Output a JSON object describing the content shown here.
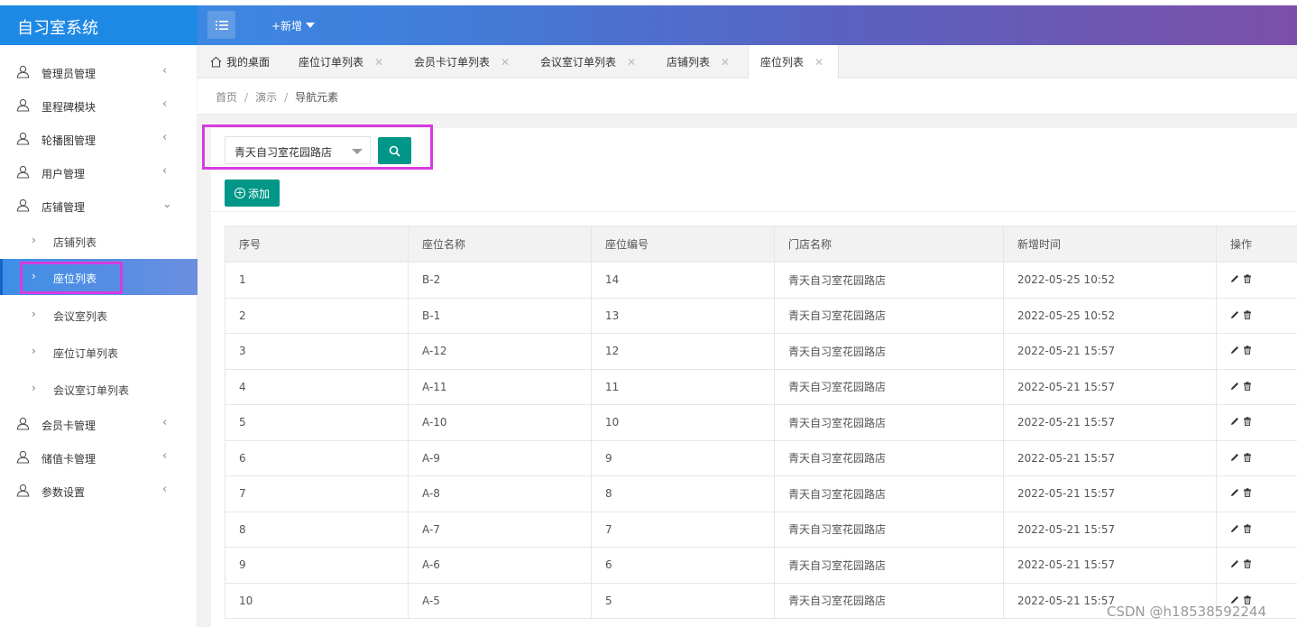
{
  "header": {
    "app_title": "自习室系统",
    "add_new_label": "+新增"
  },
  "sidebar": {
    "items": [
      {
        "label": "管理员管理"
      },
      {
        "label": "里程碑模块"
      },
      {
        "label": "轮播图管理"
      },
      {
        "label": "用户管理"
      },
      {
        "label": "店铺管理"
      }
    ],
    "sub_items": [
      {
        "label": "店铺列表"
      },
      {
        "label": "座位列表"
      },
      {
        "label": "会议室列表"
      },
      {
        "label": "座位订单列表"
      },
      {
        "label": "会议室订单列表"
      }
    ],
    "items_after": [
      {
        "label": "会员卡管理"
      },
      {
        "label": "储值卡管理"
      },
      {
        "label": "参数设置"
      }
    ]
  },
  "tabs": [
    {
      "label": "我的桌面"
    },
    {
      "label": "座位订单列表"
    },
    {
      "label": "会员卡订单列表"
    },
    {
      "label": "会议室订单列表"
    },
    {
      "label": "店铺列表"
    },
    {
      "label": "座位列表"
    }
  ],
  "breadcrumb": [
    "首页",
    "演示",
    "导航元素"
  ],
  "toolbar": {
    "store_select_value": "青天自习室花园路店",
    "add_label": "添加"
  },
  "table": {
    "headers": [
      "序号",
      "座位名称",
      "座位编号",
      "门店名称",
      "新增时间",
      "操作"
    ],
    "rows": [
      [
        "1",
        "B-2",
        "14",
        "青天自习室花园路店",
        "2022-05-25 10:52"
      ],
      [
        "2",
        "B-1",
        "13",
        "青天自习室花园路店",
        "2022-05-25 10:52"
      ],
      [
        "3",
        "A-12",
        "12",
        "青天自习室花园路店",
        "2022-05-21 15:57"
      ],
      [
        "4",
        "A-11",
        "11",
        "青天自习室花园路店",
        "2022-05-21 15:57"
      ],
      [
        "5",
        "A-10",
        "10",
        "青天自习室花园路店",
        "2022-05-21 15:57"
      ],
      [
        "6",
        "A-9",
        "9",
        "青天自习室花园路店",
        "2022-05-21 15:57"
      ],
      [
        "7",
        "A-8",
        "8",
        "青天自习室花园路店",
        "2022-05-21 15:57"
      ],
      [
        "8",
        "A-7",
        "7",
        "青天自习室花园路店",
        "2022-05-21 15:57"
      ],
      [
        "9",
        "A-6",
        "6",
        "青天自习室花园路店",
        "2022-05-21 15:57"
      ],
      [
        "10",
        "A-5",
        "5",
        "青天自习室花园路店",
        "2022-05-21 15:57"
      ]
    ]
  },
  "watermark": "CSDN @h18538592244",
  "colors": {
    "primary": "#009688",
    "sidebar_header": "#1e88e5",
    "highlight_outline": "#d63be0"
  }
}
